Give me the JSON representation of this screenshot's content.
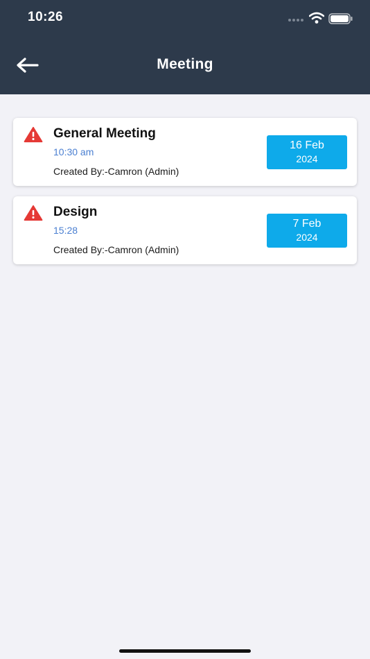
{
  "status_bar": {
    "time": "10:26",
    "signal_icon": "signal-dots-icon",
    "wifi_icon": "wifi-icon",
    "battery_icon": "battery-icon"
  },
  "header": {
    "title": "Meeting",
    "back_icon": "back-arrow-icon"
  },
  "colors": {
    "header_bg": "#2d3a4b",
    "page_bg": "#f2f2f7",
    "badge_bg": "#0eaaea",
    "time_text": "#4a7fd1",
    "warning": "#e53935"
  },
  "meetings": [
    {
      "title": "General Meeting",
      "time": "10:30 am",
      "created_by": "Created By:-Camron (Admin)",
      "date_day": "16 Feb",
      "date_year": "2024",
      "icon": "warning-icon"
    },
    {
      "title": "Design",
      "time": "15:28",
      "created_by": "Created By:-Camron (Admin)",
      "date_day": "7 Feb",
      "date_year": "2024",
      "icon": "warning-icon"
    }
  ]
}
